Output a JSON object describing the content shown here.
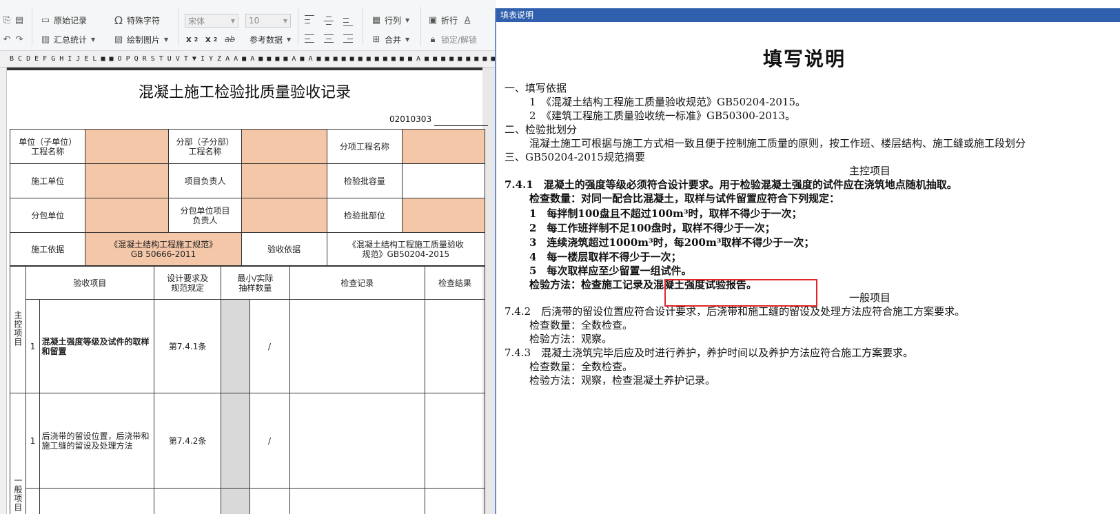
{
  "toolbar": {
    "btn_original_record": "原始记录",
    "btn_special_char": "特殊字符",
    "btn_summary": "汇总统计",
    "btn_draw_picture": "绘制图片",
    "font_name": "宋体",
    "font_size": "10",
    "superscript": "x",
    "subscript": "x",
    "strikethrough": "ab",
    "btn_reference": "参考数据",
    "btn_row_col": "行列",
    "btn_merge": "合并",
    "btn_wrap": "折行",
    "btn_lock": "锁定/解锁"
  },
  "ruler": {
    "columns": "B C D E F G H I J E L ■ ■ O P Q R S T U V T ▼ I Y Z A A ■ A ■ ■ ■ ■ A ■ A ■ ■ ■ ■ ■ ■ ■ ■ ■ ■ ■ ■ A ■ ■ ■ ■ ■ ■ ■ ■ ■ ■ ■ ■ ■ ■ ■"
  },
  "form": {
    "title": "混凝土施工检验批质量验收记录",
    "code": "02010303",
    "info": {
      "unit_label": "单位（子单位）\n工程名称",
      "subdivision_label": "分部（子分部）\n工程名称",
      "item_project_label": "分项工程名称",
      "construction_unit_label": "施工单位",
      "project_manager_label": "项目负责人",
      "batch_capacity_label": "检验批容量",
      "subcontract_unit_label": "分包单位",
      "subcontract_manager_label": "分包单位项目\n负责人",
      "batch_location_label": "检验批部位",
      "basis_label": "施工依据",
      "basis_value": "《混凝土结构工程施工规范》\nGB 50666-2011",
      "acceptance_basis_label": "验收依据",
      "acceptance_basis_value": "《混凝土结构工程施工质量验收\n规范》GB50204-2015"
    },
    "items_header": {
      "item": "验收项目",
      "design_req": "设计要求及\n规范规定",
      "min_sample": "最小/实际\n抽样数量",
      "check_record": "检查记录",
      "check_result": "检查结果"
    },
    "group_main": "主控项目",
    "group_general": "一般项目",
    "rows": [
      {
        "no": "1",
        "item": "混凝土强度等级及试件的取样和留置",
        "clause": "第7.4.1条",
        "sample": "/"
      },
      {
        "no": "1",
        "item": "后浇带的留设位置，后浇带和施工缝的留设及处理方法",
        "clause": "第7.4.2条",
        "sample": "/"
      }
    ]
  },
  "panel": {
    "titlebar": "填表说明",
    "title": "填写说明",
    "lines": [
      "一、填写依据",
      "1　《混凝土结构工程施工质量验收规范》GB50204-2015。",
      "2　《建筑工程施工质量验收统一标准》GB50300-2013。",
      "二、检验批划分",
      "混凝土施工可根据与施工方式相一致且便于控制施工质量的原则，按工作班、楼层结构、施工缝或施工段划分",
      "三、GB50204-2015规范摘要",
      "主控项目",
      "7.4.1　混凝土的强度等级必须符合设计要求。用于检验混凝土强度的试件应在浇筑地点随机抽取。",
      "检查数量：对同一配合比混凝土，取样与试件留置应符合下列规定：",
      "1　每拌制100盘且不超过100m³时，取样不得少于一次；",
      "2　每工作班拌制不足100盘时，取样不得少于一次；",
      "3　连续浇筑超过1000m³时，每200m³取样不得少于一次；",
      "4　每一楼层取样不得少于一次；",
      "5　每次取样应至少留置一组试件。",
      "检验方法：检查施工记录及混凝土强度试验报告。",
      "一般项目",
      "7.4.2　后浇带的留设位置应符合设计要求，后浇带和施工缝的留设及处理方法应符合施工方案要求。",
      "检查数量：全数检查。",
      "检验方法：观察。",
      "7.4.3　混凝土浇筑完毕后应及时进行养护，养护时间以及养护方法应符合施工方案要求。",
      "检查数量：全数检查。",
      "检验方法：观察，检查混凝土养护记录。"
    ]
  },
  "colors": {
    "peach_cell": "#f4c7a8",
    "titlebar_blue": "#2f5fad",
    "highlight_red": "#e0262a"
  }
}
